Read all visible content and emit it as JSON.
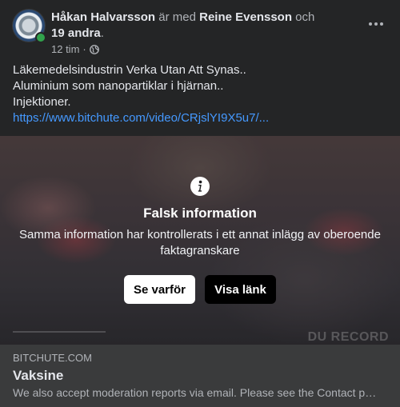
{
  "post": {
    "author": "Håkan Halvarsson",
    "with_text": " är med ",
    "tagged": "Reine Evensson",
    "and_text": " och",
    "others": "19 andra",
    "period": ".",
    "time": "12 tim",
    "separator": "·",
    "body_lines": [
      "Läkemedelsindustrin Verka Utan Att Synas..",
      "Aluminium som nanopartiklar i hjärnan..",
      "Injektioner."
    ],
    "link": "https://www.bitchute.com/video/CRjslYI9X5u7/..."
  },
  "fact_check": {
    "title": "Falsk information",
    "subtitle": "Samma information har kontrollerats i ett annat inlägg av oberoende faktagranskare",
    "why_button": "Se varför",
    "show_link_button": "Visa länk",
    "watermark": "DU RECORD"
  },
  "link_preview": {
    "domain": "BITCHUTE.COM",
    "title": "Vaksine",
    "description": "We also accept moderation reports via email. Please see the Contact page for more details."
  },
  "colors": {
    "background": "#242526",
    "link": "#4599ff",
    "online": "#31a24c"
  }
}
